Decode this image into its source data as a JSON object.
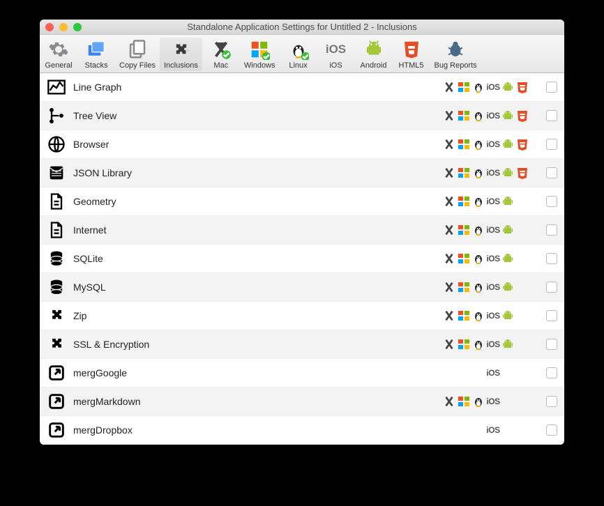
{
  "window": {
    "title": "Standalone Application Settings for Untitled 2 - Inclusions"
  },
  "toolbar": [
    {
      "id": "general",
      "label": "General"
    },
    {
      "id": "stacks",
      "label": "Stacks"
    },
    {
      "id": "copyfiles",
      "label": "Copy Files"
    },
    {
      "id": "inclusions",
      "label": "Inclusions",
      "selected": true
    },
    {
      "id": "mac",
      "label": "Mac"
    },
    {
      "id": "windows",
      "label": "Windows"
    },
    {
      "id": "linux",
      "label": "Linux"
    },
    {
      "id": "ios",
      "label": "iOS"
    },
    {
      "id": "android",
      "label": "Android"
    },
    {
      "id": "html5",
      "label": "HTML5"
    },
    {
      "id": "bugreports",
      "label": "Bug Reports"
    }
  ],
  "rows": [
    {
      "icon": "linegraph",
      "label": "Line Graph",
      "platforms": [
        "mac",
        "win",
        "linux",
        "ios",
        "android",
        "html5"
      ]
    },
    {
      "icon": "treeview",
      "label": "Tree View",
      "platforms": [
        "mac",
        "win",
        "linux",
        "ios",
        "android",
        "html5"
      ]
    },
    {
      "icon": "browser",
      "label": "Browser",
      "platforms": [
        "mac",
        "win",
        "linux",
        "ios",
        "android",
        "html5"
      ]
    },
    {
      "icon": "json",
      "label": "JSON Library",
      "platforms": [
        "mac",
        "win",
        "linux",
        "ios",
        "android",
        "html5"
      ]
    },
    {
      "icon": "doc",
      "label": "Geometry",
      "platforms": [
        "mac",
        "win",
        "linux",
        "ios",
        "android"
      ]
    },
    {
      "icon": "doc",
      "label": "Internet",
      "platforms": [
        "mac",
        "win",
        "linux",
        "ios",
        "android"
      ]
    },
    {
      "icon": "db",
      "label": "SQLite",
      "platforms": [
        "mac",
        "win",
        "linux",
        "ios",
        "android"
      ]
    },
    {
      "icon": "db",
      "label": "MySQL",
      "platforms": [
        "mac",
        "win",
        "linux",
        "ios",
        "android"
      ]
    },
    {
      "icon": "puzzle",
      "label": "Zip",
      "platforms": [
        "mac",
        "win",
        "linux",
        "ios",
        "android"
      ]
    },
    {
      "icon": "puzzle",
      "label": "SSL & Encryption",
      "platforms": [
        "mac",
        "win",
        "linux",
        "ios",
        "android"
      ]
    },
    {
      "icon": "ext",
      "label": "mergGoogle",
      "platforms": [
        "ios"
      ]
    },
    {
      "icon": "ext",
      "label": "mergMarkdown",
      "platforms": [
        "mac",
        "win",
        "linux",
        "ios"
      ]
    },
    {
      "icon": "ext",
      "label": "mergDropbox",
      "platforms": [
        "ios"
      ]
    }
  ]
}
